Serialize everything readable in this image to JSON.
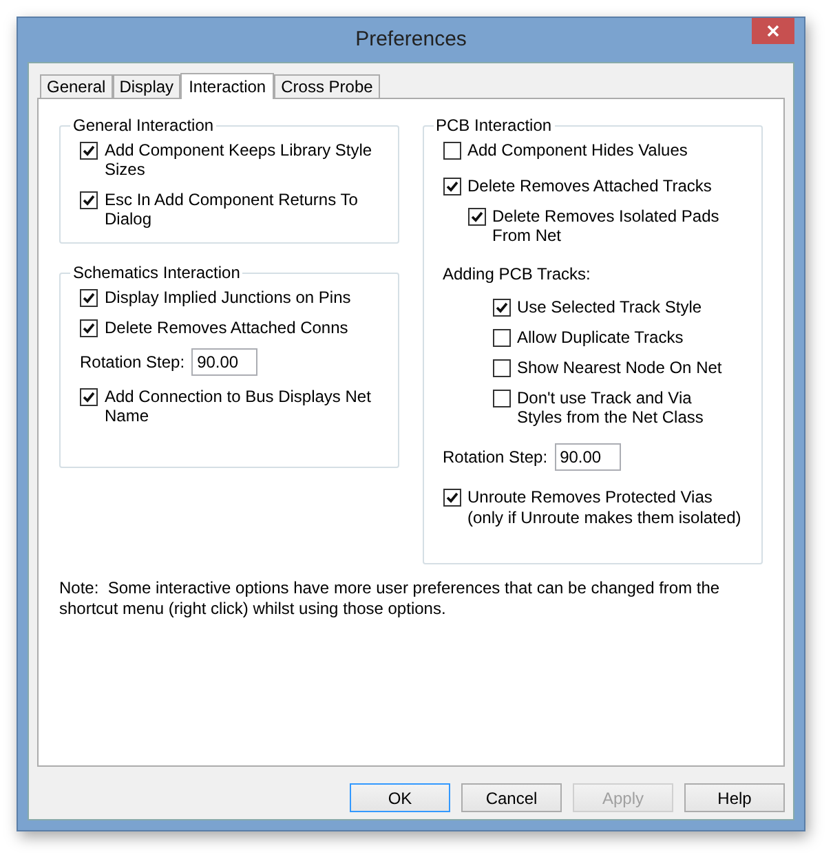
{
  "window": {
    "title": "Preferences"
  },
  "tabs": [
    {
      "label": "General",
      "selected": false
    },
    {
      "label": "Display",
      "selected": false
    },
    {
      "label": "Interaction",
      "selected": true
    },
    {
      "label": "Cross Probe",
      "selected": false
    }
  ],
  "general_interaction": {
    "title": "General Interaction",
    "items": [
      {
        "kind": "checkbox",
        "label": "Add Component Keeps Library Style Sizes",
        "checked": true
      },
      {
        "kind": "checkbox",
        "label": "Esc In Add Component Returns To Dialog",
        "checked": true
      }
    ]
  },
  "schematics_interaction": {
    "title": "Schematics Interaction",
    "items": [
      {
        "kind": "checkbox",
        "label": "Display Implied Junctions on Pins",
        "checked": true
      },
      {
        "kind": "checkbox",
        "label": "Delete Removes Attached Conns",
        "checked": true
      },
      {
        "kind": "field",
        "label": "Rotation Step:",
        "value": "90.00"
      },
      {
        "kind": "checkbox",
        "label": "Add Connection to Bus Displays Net Name",
        "checked": true
      }
    ]
  },
  "pcb_interaction": {
    "title": "PCB Interaction",
    "items": [
      {
        "kind": "checkbox",
        "label": "Add Component Hides Values",
        "checked": false
      },
      {
        "kind": "checkbox",
        "label": "Delete Removes Attached Tracks",
        "checked": true,
        "children": [
          {
            "kind": "checkbox",
            "label": "Delete Removes Isolated Pads From Net",
            "checked": true
          }
        ]
      },
      {
        "kind": "label",
        "label": "Adding PCB Tracks:",
        "children": [
          {
            "kind": "checkbox",
            "label": "Use Selected Track Style",
            "checked": true
          },
          {
            "kind": "checkbox",
            "label": "Allow Duplicate Tracks",
            "checked": false
          },
          {
            "kind": "checkbox",
            "label": "Show Nearest Node On Net",
            "checked": false
          },
          {
            "kind": "checkbox",
            "label": "Don't use Track and Via Styles from the Net Class",
            "checked": false
          }
        ]
      },
      {
        "kind": "field",
        "label": "Rotation Step:",
        "value": "90.00"
      },
      {
        "kind": "checkbox",
        "label": "Unroute Removes Protected Vias",
        "checked": true,
        "note": "(only if Unroute makes them isolated)"
      }
    ]
  },
  "note": "Note:  Some interactive options have more user preferences that can be changed from the shortcut menu (right click) whilst using those options.",
  "buttons": [
    {
      "label": "OK",
      "default": true,
      "disabled": false
    },
    {
      "label": "Cancel",
      "default": false,
      "disabled": false
    },
    {
      "label": "Apply",
      "default": false,
      "disabled": true
    },
    {
      "label": "Help",
      "default": false,
      "disabled": false
    }
  ]
}
